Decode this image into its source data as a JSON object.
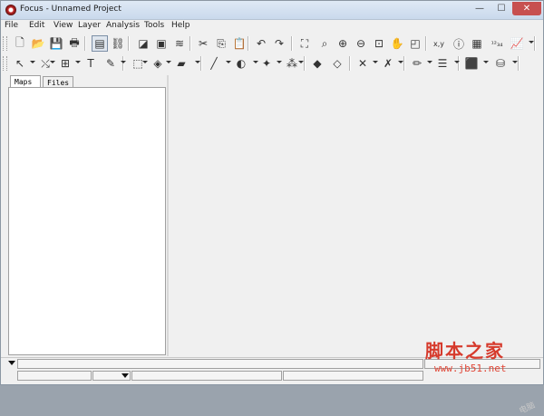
{
  "window": {
    "title": "Focus - Unnamed Project"
  },
  "menu": [
    "File",
    "Edit",
    "View",
    "Layer",
    "Analysis",
    "Tools",
    "Help"
  ],
  "toolbar1": [
    {
      "name": "new-file-icon",
      "glyph": "🗋"
    },
    {
      "name": "open-folder-icon",
      "glyph": "📂"
    },
    {
      "name": "save-icon",
      "glyph": "💾"
    },
    {
      "name": "print-icon",
      "glyph": "🖶"
    },
    {
      "name": "map-document-icon",
      "glyph": "▤",
      "active": true
    },
    {
      "name": "link-icon",
      "glyph": "⛓"
    },
    {
      "name": "eraser-icon",
      "glyph": "◪"
    },
    {
      "name": "frame-icon",
      "glyph": "▣"
    },
    {
      "name": "layers-icon",
      "glyph": "≋"
    },
    {
      "name": "cut-icon",
      "glyph": "✂"
    },
    {
      "name": "copy-icon",
      "glyph": "⎘"
    },
    {
      "name": "paste-icon",
      "glyph": "📋"
    },
    {
      "name": "undo-icon",
      "glyph": "↶"
    },
    {
      "name": "redo-icon",
      "glyph": "↷"
    },
    {
      "name": "zoom-extent-icon",
      "glyph": "⛶"
    },
    {
      "name": "zoom-window-icon",
      "glyph": "⌕"
    },
    {
      "name": "zoom-in-icon",
      "glyph": "⊕"
    },
    {
      "name": "zoom-out-icon",
      "glyph": "⊖"
    },
    {
      "name": "zoom-layer-icon",
      "glyph": "⊡"
    },
    {
      "name": "pan-hand-icon",
      "glyph": "✋"
    },
    {
      "name": "zoom-previous-icon",
      "glyph": "◰"
    },
    {
      "name": "xy-coordinate-icon",
      "glyph": "x,y"
    },
    {
      "name": "info-icon",
      "glyph": "ⓘ"
    },
    {
      "name": "attribute-table-icon",
      "glyph": "▦"
    },
    {
      "name": "numbering-icon",
      "glyph": "¹²₃₄"
    },
    {
      "name": "chart-tool-icon",
      "glyph": "📈"
    }
  ],
  "toolbar2": [
    {
      "name": "select-arrow-icon",
      "glyph": "↖"
    },
    {
      "name": "edit-vertex-icon",
      "glyph": "⤯"
    },
    {
      "name": "grid-icon",
      "glyph": "⊞"
    },
    {
      "name": "text-tool-icon",
      "glyph": "T"
    },
    {
      "name": "brush-icon",
      "glyph": "✎"
    },
    {
      "name": "dotted-select-icon",
      "glyph": "⬚"
    },
    {
      "name": "fill-icon",
      "glyph": "◈"
    },
    {
      "name": "symbol-icon",
      "glyph": "▰"
    },
    {
      "name": "line-tool-icon",
      "glyph": "╱"
    },
    {
      "name": "shape-icon",
      "glyph": "◐"
    },
    {
      "name": "point-icon",
      "glyph": "✦"
    },
    {
      "name": "color-circles-icon",
      "glyph": "⁂"
    },
    {
      "name": "layer-add-icon",
      "glyph": "◆"
    },
    {
      "name": "layer-stack-icon",
      "glyph": "◇"
    },
    {
      "name": "marker-x-icon",
      "glyph": "✕"
    },
    {
      "name": "marker-cross-icon",
      "glyph": "✗"
    },
    {
      "name": "line-color-icon",
      "glyph": "✏"
    },
    {
      "name": "line-style-icon",
      "glyph": "☰"
    },
    {
      "name": "fill-color-icon",
      "glyph": "⬛"
    },
    {
      "name": "paint-bucket-icon",
      "glyph": "⛁"
    }
  ],
  "tabs": {
    "maps": "Maps",
    "files": "Files"
  },
  "watermark": {
    "cn": "脚本之家",
    "url": "www.jb51.net",
    "faint": "电脑"
  }
}
